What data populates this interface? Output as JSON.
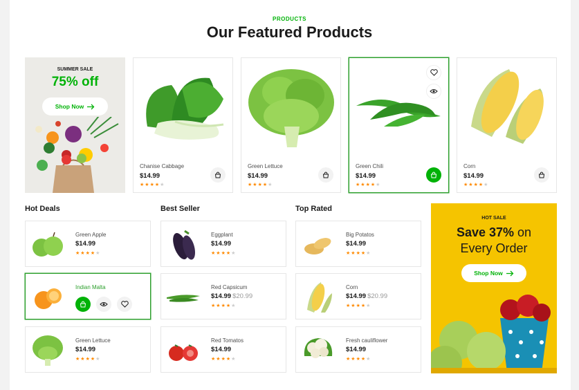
{
  "section": {
    "eyebrow": "PRODUCTS",
    "title": "Our Featured Products"
  },
  "summer_promo": {
    "label": "SUMMER SALE",
    "headline": "75% off",
    "button": "Shop Now"
  },
  "featured": [
    {
      "name": "Chanise Cabbage",
      "price": "$14.99",
      "rating": 4
    },
    {
      "name": "Green Lettuce",
      "price": "$14.99",
      "rating": 4
    },
    {
      "name": "Green Chili",
      "price": "$14.99",
      "rating": 4
    },
    {
      "name": "Corn",
      "price": "$14.99",
      "rating": 4
    }
  ],
  "columns": {
    "hot_deals": {
      "title": "Hot Deals",
      "items": [
        {
          "name": "Green Apple",
          "price": "$14.99",
          "rating": 4
        },
        {
          "name": "Indian Malta",
          "price": "",
          "rating": 4
        },
        {
          "name": "Green Lettuce",
          "price": "$14.99",
          "rating": 4
        }
      ]
    },
    "best_seller": {
      "title": "Best Seller",
      "items": [
        {
          "name": "Eggplant",
          "price": "$14.99",
          "rating": 4
        },
        {
          "name": "Red Capsicum",
          "price": "$14.99",
          "old_price": "$20.99",
          "rating": 4
        },
        {
          "name": "Red Tomatos",
          "price": "$14.99",
          "rating": 4
        }
      ]
    },
    "top_rated": {
      "title": "Top Rated",
      "items": [
        {
          "name": "Big Potatos",
          "price": "$14.99",
          "rating": 4
        },
        {
          "name": "Corn",
          "price": "$14.99",
          "old_price": "$20.99",
          "rating": 4
        },
        {
          "name": "Fresh cauliflower",
          "price": "$14.99",
          "rating": 4
        }
      ]
    }
  },
  "hot_sale": {
    "label": "HOT SALE",
    "headline_bold": "Save 37%",
    "headline_rest": " on",
    "headline_line2": "Every Order",
    "button": "Shop Now"
  },
  "icons": {
    "cart": "shopping-bag-icon",
    "wishlist": "heart-icon",
    "quick_view": "eye-icon",
    "arrow": "arrow-right-icon",
    "star": "star-icon"
  },
  "colors": {
    "brand": "#00b207",
    "star": "#ff8a00",
    "hot_sale_bg": "#f5c400",
    "active_border": "#2c9f2c"
  }
}
